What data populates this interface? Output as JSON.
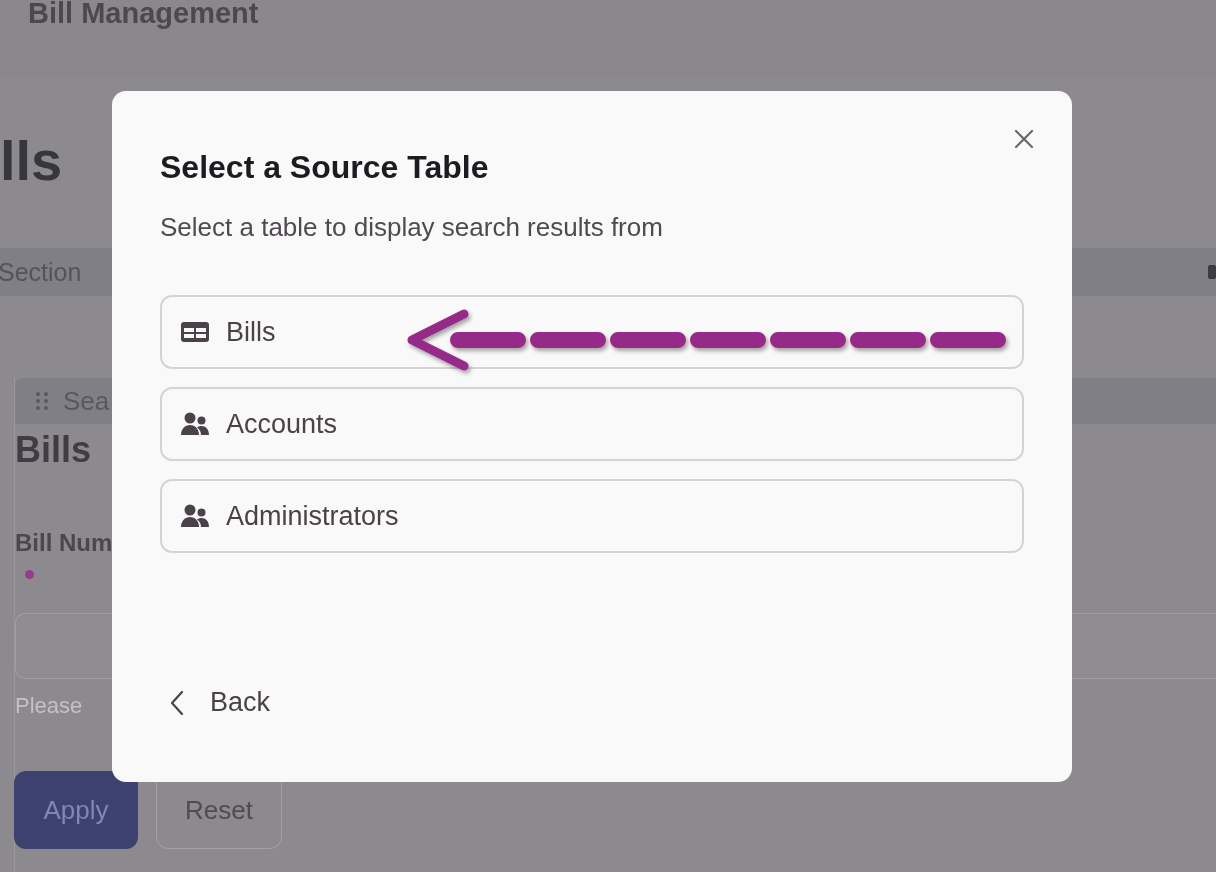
{
  "page": {
    "header_title": "Bill Management",
    "heading": "lls",
    "section_bar": "Section",
    "card": {
      "header": "Sea",
      "title": "Bills",
      "field_label": "Bill Num",
      "required": true,
      "helper": "Please",
      "buttons": [
        {
          "label": "Apply",
          "kind": "primary"
        },
        {
          "label": "Reset",
          "kind": "secondary"
        }
      ]
    }
  },
  "modal": {
    "title": "Select a Source Table",
    "subtitle": "Select a table to display search results from",
    "options": [
      {
        "label": "Bills",
        "kind": "table"
      },
      {
        "label": "Accounts",
        "kind": "users"
      },
      {
        "label": "Administrators",
        "kind": "users"
      }
    ],
    "back": "Back"
  }
}
